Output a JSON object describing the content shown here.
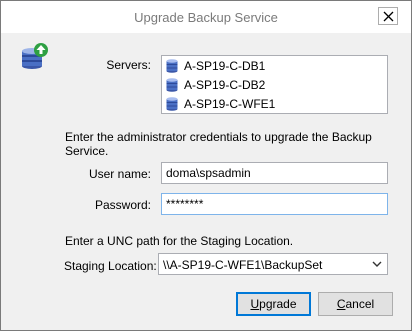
{
  "window": {
    "title": "Upgrade Backup Service"
  },
  "servers": {
    "label": "Servers:",
    "items": [
      {
        "name": "A-SP19-C-DB1"
      },
      {
        "name": "A-SP19-C-DB2"
      },
      {
        "name": "A-SP19-C-WFE1"
      }
    ]
  },
  "credentials": {
    "instruction_line1": "Enter the administrator credentials to upgrade the Backup",
    "instruction_line2": "Service.",
    "username_label": "User name:",
    "username_value": "doma\\spsadmin",
    "password_label": "Password:",
    "password_value": "********"
  },
  "staging": {
    "instruction": "Enter a UNC path for the Staging Location.",
    "label": "Staging Location:",
    "value": "\\\\A-SP19-C-WFE1\\BackupSet"
  },
  "buttons": {
    "upgrade_mnemonic": "U",
    "upgrade_rest": "pgrade",
    "cancel_mnemonic": "C",
    "cancel_rest": "ancel"
  },
  "icons": {
    "app": "database-upgrade-icon",
    "server": "server-database-icon",
    "close": "close-icon",
    "dropdown": "chevron-down-icon"
  }
}
